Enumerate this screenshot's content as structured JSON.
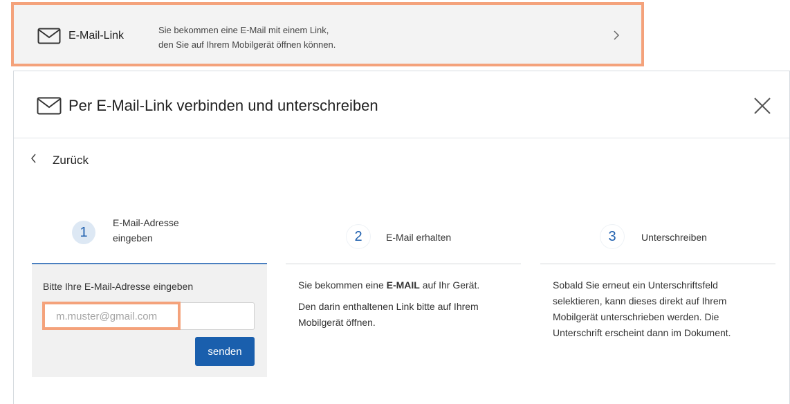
{
  "option": {
    "icon": "envelope-icon",
    "title": "E-Mail-Link",
    "description_line1": "Sie bekommen eine E-Mail mit einem Link,",
    "description_line2": "den Sie auf Ihrem Mobilgerät öffnen können.",
    "chevron_icon": "chevron-right-icon",
    "highlight_color": "#f4a27b"
  },
  "dialog": {
    "title": "Per E-Mail-Link verbinden und unterschreiben",
    "close_icon": "close-icon",
    "back_label": "Zurück"
  },
  "steps": [
    {
      "number": "1",
      "title_line1": "E-Mail-Adresse",
      "title_line2": "eingeben",
      "active": true
    },
    {
      "number": "2",
      "title_line1": "E-Mail erhalten",
      "active": false
    },
    {
      "number": "3",
      "title_line1": "Unterschreiben",
      "active": false
    }
  ],
  "step1_body": {
    "prompt": "Bitte Ihre E-Mail-Adresse eingeben",
    "email_placeholder": "m.muster@gmail.com",
    "email_value": "",
    "send_label": "senden"
  },
  "step2_body": {
    "para1_prefix": "Sie bekommen eine ",
    "para1_bold": "E-MAIL",
    "para1_suffix": " auf Ihr Gerät.",
    "para2": "Den darin enthaltenen Link bitte auf Ihrem Mobilgerät öffnen."
  },
  "step3_body": {
    "para1": "Sobald Sie erneut ein Unterschriftsfeld selektieren, kann dieses direkt auf Ihrem Mobilgerät unterschrieben werden. Die Unterschrift erscheint dann im Dokument."
  },
  "colors": {
    "accent": "#1a5fad",
    "step_active_bg": "#dde8f4",
    "highlight": "#f4a27b"
  }
}
